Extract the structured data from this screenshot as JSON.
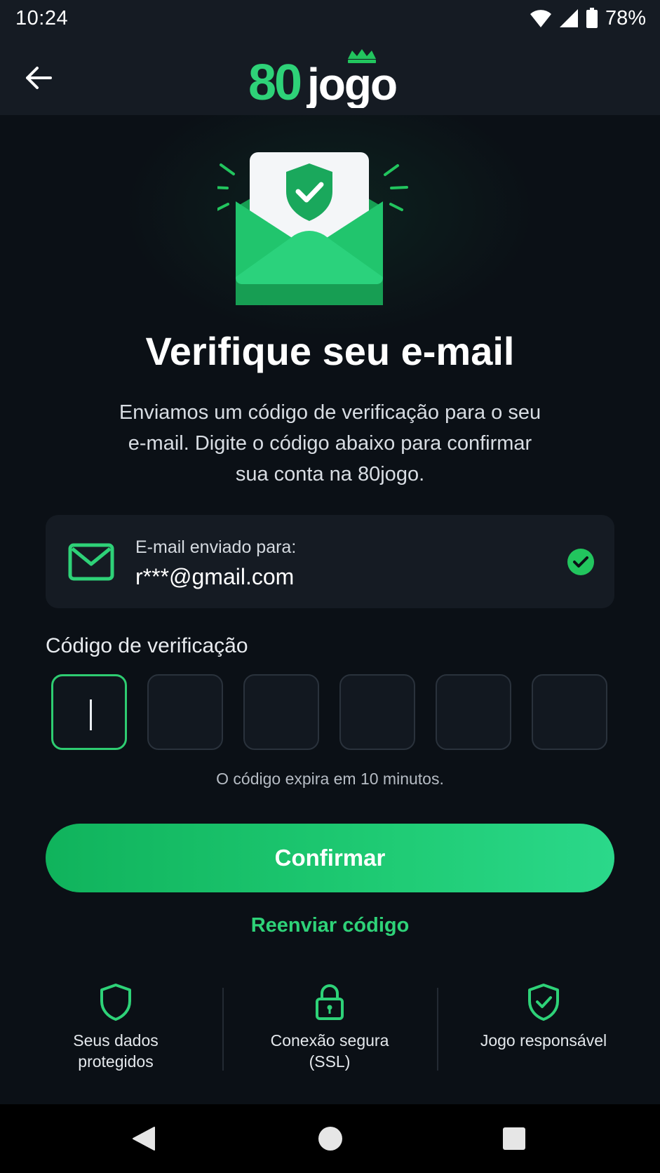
{
  "status_bar": {
    "time": "10:24",
    "battery_percent": "78%",
    "icons": [
      "wifi-icon",
      "signal-icon",
      "battery-icon"
    ]
  },
  "header": {
    "back_icon": "arrow-left-icon",
    "logo_number": "80",
    "logo_word": "jogo",
    "logo_icon": "crown-icon"
  },
  "colors": {
    "brand_green": "#2ed278",
    "button_green": "#1fcb74",
    "background": "#0b1016",
    "card": "#151b23"
  },
  "main": {
    "hero_icon": "envelope-shield-check-icon",
    "title": "Verifique seu e-mail",
    "subtitle_lines": [
      "Enviamos um código de verificação para o seu",
      "e-mail. Digite o código abaixo para confirmar",
      "sua conta na 80jogo."
    ]
  },
  "email_card": {
    "icon": "mail-icon",
    "label": "E-mail enviado para:",
    "value": "r***@gmail.com",
    "status_icon": "check-circle-icon"
  },
  "code": {
    "label": "Código de verificação",
    "digits": [
      "",
      "",
      "",
      "",
      "",
      ""
    ],
    "active_index": 0,
    "expire_text": "O código expira em 10 minutos."
  },
  "actions": {
    "confirm_label": "Confirmar",
    "resend_label": "Reenviar código"
  },
  "trust": [
    {
      "icon": "shield-icon",
      "lines": [
        "Seus dados",
        "protegidos"
      ]
    },
    {
      "icon": "lock-icon",
      "lines": [
        "Conexão segura",
        "(SSL)"
      ]
    },
    {
      "icon": "shield-check-icon",
      "lines": [
        "Jogo responsável"
      ]
    }
  ],
  "nav_bar": {
    "back_icon": "nav-back-icon",
    "home_icon": "nav-home-icon",
    "recents_icon": "nav-recents-icon"
  }
}
